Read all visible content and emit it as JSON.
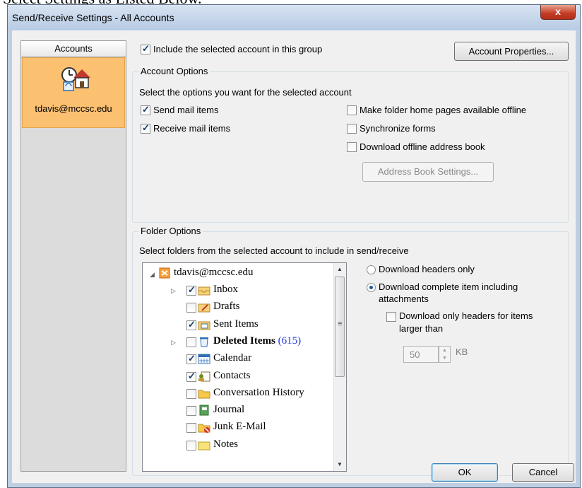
{
  "window": {
    "title": "Send/Receive Settings - All Accounts",
    "close_glyph": "x"
  },
  "accounts_pane": {
    "header": "Accounts",
    "account": "tdavis@mccsc.edu"
  },
  "include_checkbox": {
    "label": "Include the selected account in this group",
    "checked": true
  },
  "buttons": {
    "account_properties": "Account Properties...",
    "address_book_settings": "Address Book Settings...",
    "ok": "OK",
    "cancel": "Cancel"
  },
  "account_options": {
    "title": "Account Options",
    "instruction": "Select the options you want for the selected account",
    "send_mail": "Send mail items",
    "receive_mail": "Receive mail items",
    "folder_home_pages": "Make folder home pages available offline",
    "sync_forms": "Synchronize forms",
    "offline_address_book": "Download offline address book"
  },
  "folder_options": {
    "title": "Folder Options",
    "instruction": "Select folders from the selected account to include in send/receive",
    "tree": {
      "root": "tdavis@mccsc.edu",
      "folders": [
        {
          "label": "Inbox",
          "checked": true,
          "expander": true,
          "icon": "inbox-icon"
        },
        {
          "label": "Drafts",
          "checked": false,
          "expander": false,
          "icon": "drafts-icon"
        },
        {
          "label": "Sent Items",
          "checked": true,
          "expander": false,
          "icon": "sent-items-icon"
        },
        {
          "label": "Deleted Items",
          "count": "(615)",
          "checked": false,
          "expander": true,
          "bold": true,
          "icon": "deleted-items-icon"
        },
        {
          "label": "Calendar",
          "checked": true,
          "expander": false,
          "icon": "calendar-icon"
        },
        {
          "label": "Contacts",
          "checked": true,
          "expander": false,
          "icon": "contacts-icon"
        },
        {
          "label": "Conversation History",
          "checked": false,
          "expander": false,
          "icon": "folder-icon"
        },
        {
          "label": "Journal",
          "checked": false,
          "expander": false,
          "icon": "journal-icon"
        },
        {
          "label": "Junk E-Mail",
          "checked": false,
          "expander": false,
          "icon": "junk-email-icon"
        },
        {
          "label": "Notes",
          "checked": false,
          "expander": false,
          "icon": "notes-icon"
        }
      ]
    },
    "download_headers_only": "Download headers only",
    "download_complete_line1": "Download complete item including",
    "download_complete_line2": "attachments",
    "headers_larger_line1": "Download only headers for items",
    "headers_larger_line2": "larger than",
    "size_value": "50",
    "size_unit": "KB"
  }
}
